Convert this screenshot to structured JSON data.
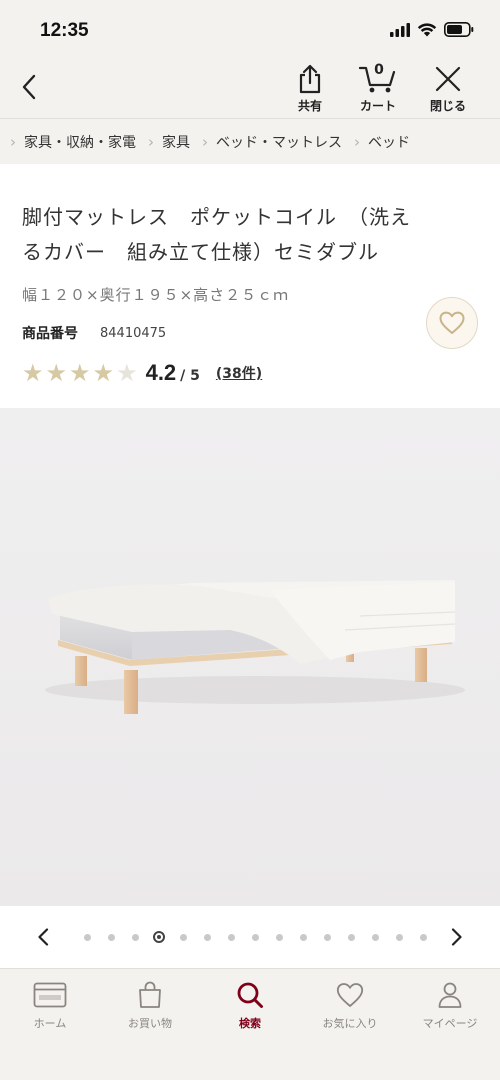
{
  "status_bar": {
    "time": "12:35"
  },
  "header": {
    "share_label": "共有",
    "cart_label": "カート",
    "cart_count": "0",
    "close_label": "閉じる"
  },
  "breadcrumb": [
    {
      "label": "家具・収納・家電"
    },
    {
      "label": "家具"
    },
    {
      "label": "ベッド・マットレス"
    },
    {
      "label": "ベッド"
    }
  ],
  "product": {
    "title_line1": "脚付マットレス　ポケットコイル　（洗え",
    "title_line2": "るカバー　組み立て仕様）セミダブル",
    "dimensions": "幅１２０×奥行１９５×高さ２５ｃｍ",
    "code_label": "商品番号",
    "code_value": "84410475",
    "rating": "4.2",
    "rating_max": "/ 5",
    "review_count": "(38件)",
    "stars_full": 4,
    "stars_total": 5
  },
  "carousel": {
    "total": 15,
    "active_index": 3
  },
  "tabbar": {
    "items": [
      {
        "label": "ホーム",
        "icon": "store-card-icon"
      },
      {
        "label": "お買い物",
        "icon": "shopping-bag-icon"
      },
      {
        "label": "検索",
        "icon": "search-icon"
      },
      {
        "label": "お気に入り",
        "icon": "heart-icon"
      },
      {
        "label": "マイページ",
        "icon": "person-icon"
      }
    ],
    "active_index": 2
  },
  "colors": {
    "accent": "#7f0019",
    "star": "#d6c9a3",
    "background": "#f4f2ef"
  }
}
